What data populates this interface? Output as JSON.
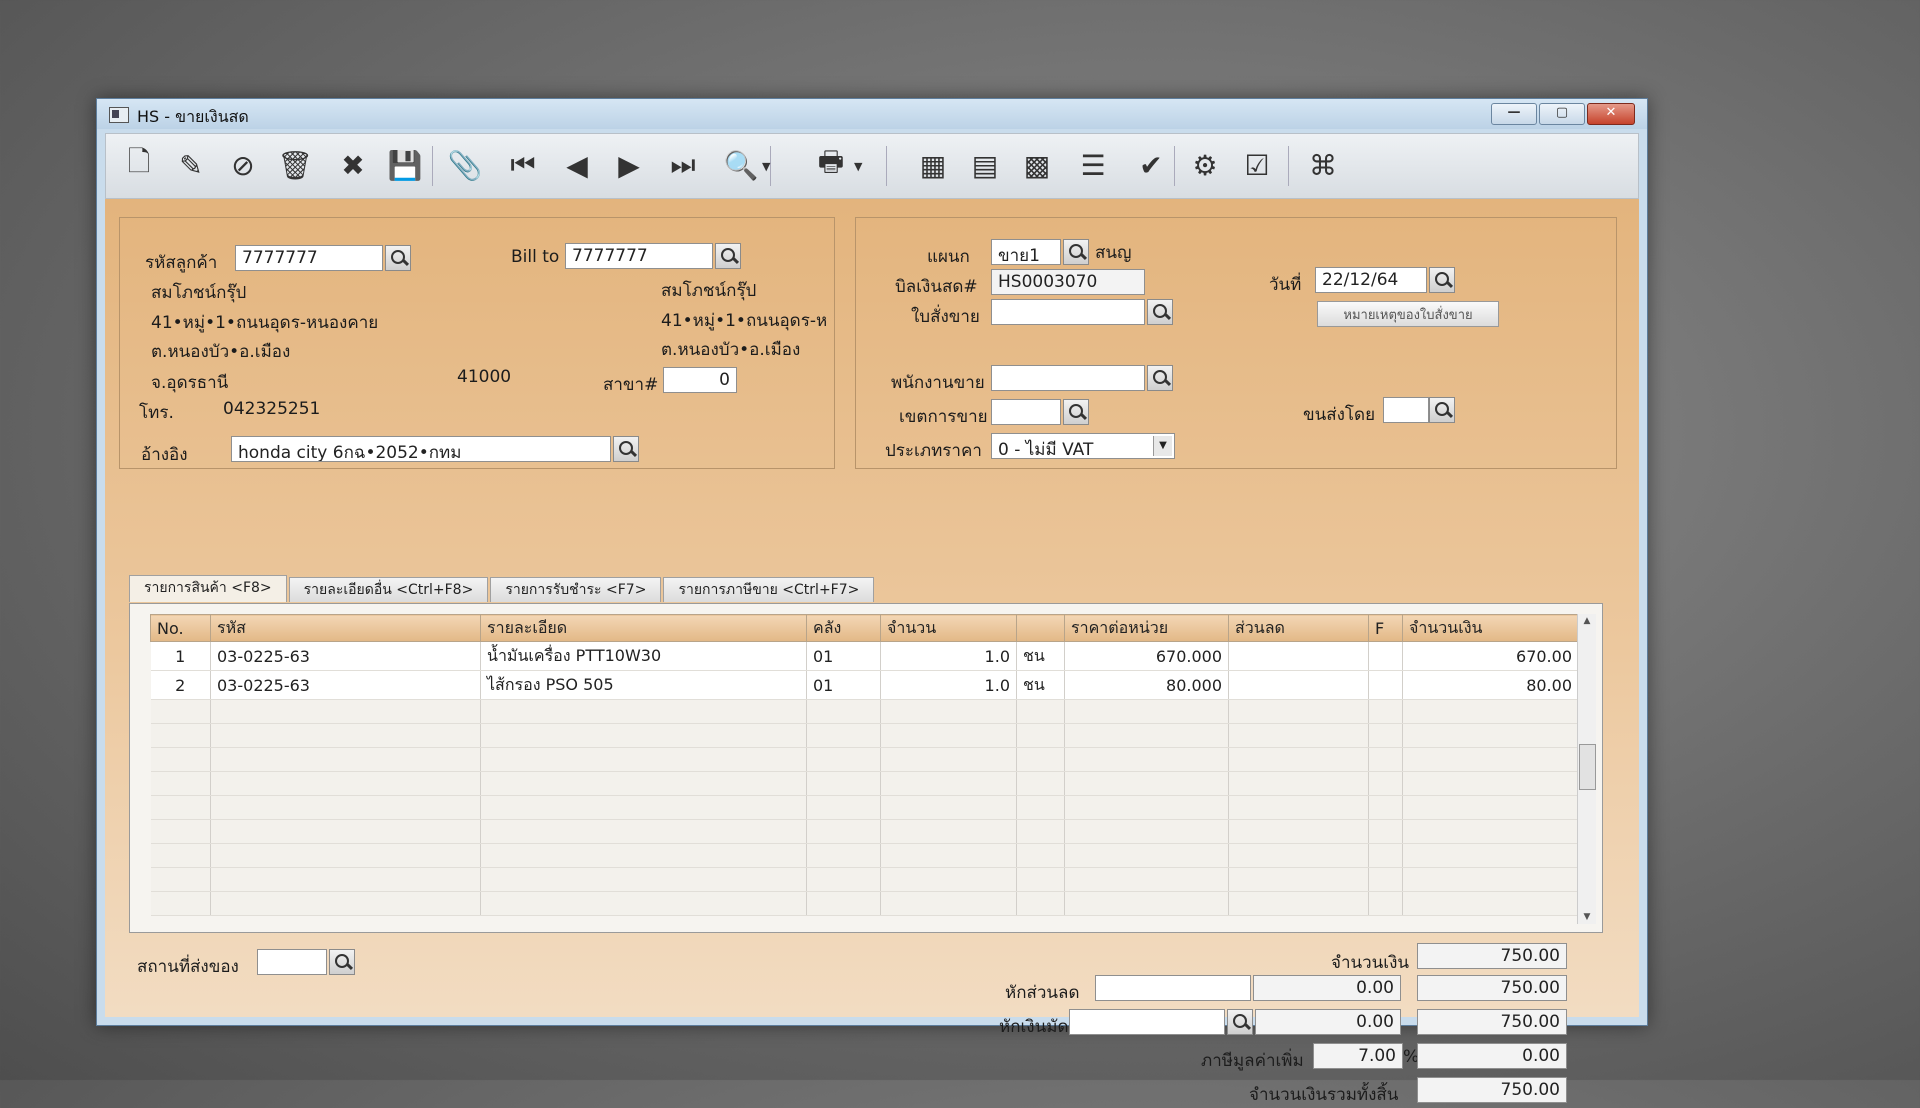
{
  "window": {
    "title": "HS - ขายเงินสด"
  },
  "titlebar_buttons": {
    "minimize": "—",
    "maximize": "▢",
    "close": "✕"
  },
  "toolbar": [
    {
      "name": "new-document-icon",
      "glyph": "🗋"
    },
    {
      "name": "edit-icon",
      "glyph": "✎"
    },
    {
      "name": "void-icon",
      "glyph": "⊘"
    },
    {
      "name": "trash-icon",
      "glyph": "🗑"
    },
    {
      "name": "cancel-icon",
      "glyph": "✖"
    },
    {
      "name": "save-icon",
      "glyph": "💾"
    },
    {
      "name": "attach-icon",
      "glyph": "📎"
    },
    {
      "name": "first-record-icon",
      "glyph": "⏮"
    },
    {
      "name": "previous-record-icon",
      "glyph": "◀"
    },
    {
      "name": "next-record-icon",
      "glyph": "▶"
    },
    {
      "name": "last-record-icon",
      "glyph": "⏭"
    },
    {
      "name": "find-icon",
      "glyph": "🔍"
    },
    {
      "name": "print-icon",
      "glyph": "🖶"
    },
    {
      "name": "calculator-icon",
      "glyph": "▦"
    },
    {
      "name": "report-icon",
      "glyph": "▤"
    },
    {
      "name": "spreadsheet-icon",
      "glyph": "▩"
    },
    {
      "name": "ledger-icon",
      "glyph": "☰"
    },
    {
      "name": "approve-icon",
      "glyph": "✔"
    },
    {
      "name": "tools-icon",
      "glyph": "⚙"
    },
    {
      "name": "ok-icon",
      "glyph": "☑"
    },
    {
      "name": "network-icon",
      "glyph": "⌘"
    }
  ],
  "customer": {
    "code_label": "รหัสลูกค้า",
    "code": "7777777",
    "name": "สมโภชน์กรุ๊ป",
    "address1": "41•หมู่•1•ถนนอุดร-หนองคาย",
    "address2": "ต.หนองบัว•อ.เมือง",
    "address3": "จ.อุดรธานี",
    "postcode": "41000",
    "phone_label": "โทร.",
    "phone": "042325251",
    "ref_label": "อ้างอิง",
    "ref": "honda city 6กฉ•2052•กทม"
  },
  "bill_to": {
    "label": "Bill to",
    "code": "7777777",
    "name": "สมโภชน์กรุ๊ป",
    "address1": "41•หมู่•1•ถนนอุดร-ห",
    "address2": "ต.หนองบัว•อ.เมือง",
    "branch_label": "สาขา#",
    "branch": "0"
  },
  "doc": {
    "dept_label": "แผนก",
    "dept": "ขาย1",
    "dept_name": "สนญ",
    "bill_label": "บิลเงินสด#",
    "bill": "HS0003070",
    "date_label": "วันที่",
    "date": "22/12/64",
    "order_label": "ใบสั่งขาย",
    "order": "",
    "order_note_button": "หมายเหตุของใบสั่งขาย",
    "salesman_label": "พนักงานขาย",
    "salesman": "",
    "area_label": "เขตการขาย",
    "area": "",
    "ship_label": "ขนส่งโดย",
    "ship": "",
    "price_type_label": "ประเภทราคา",
    "price_type": "0 - ไม่มี VAT"
  },
  "tabs": [
    {
      "label": "รายการสินค้า <F8>"
    },
    {
      "label": "รายละเอียดอื่น <Ctrl+F8>"
    },
    {
      "label": "รายการรับชำระ <F7>"
    },
    {
      "label": "รายการภาษีขาย <Ctrl+F7>"
    }
  ],
  "grid": {
    "headers": [
      "No.",
      "รหัส",
      "รายละเอียด",
      "คลัง",
      "จำนวน",
      "",
      "ราคาต่อหน่วย",
      "ส่วนลด",
      "F",
      "จำนวนเงิน"
    ],
    "rows": [
      [
        "1",
        "03-0225-63",
        "น้ำมันเครื่อง PTT10W30",
        "01",
        "1.0",
        "ชน",
        "670.000",
        "",
        "",
        "670.00"
      ],
      [
        "2",
        "03-0225-63",
        "ไส้กรอง PSO 505",
        "01",
        "1.0",
        "ชน",
        "80.000",
        "",
        "",
        "80.00"
      ]
    ]
  },
  "footer": {
    "delivery_label": "สถานที่ส่งของ",
    "delivery": "",
    "amount_label": "จำนวนเงิน",
    "amount": "750.00",
    "discount_label": "หักส่วนลด",
    "discount_input": "",
    "discount_value": "0.00",
    "after_discount": "750.00",
    "deposit_label": "หักเงินมัดจำ",
    "deposit_input": "",
    "deposit_value": "0.00",
    "after_deposit": "750.00",
    "vat_label": "ภาษีมูลค่าเพิ่ม",
    "vat_rate": "7.00",
    "vat_pct": "%",
    "vat_amount": "0.00",
    "total_label": "จำนวนเงินรวมทั้งสิ้น",
    "total": "750.00"
  }
}
